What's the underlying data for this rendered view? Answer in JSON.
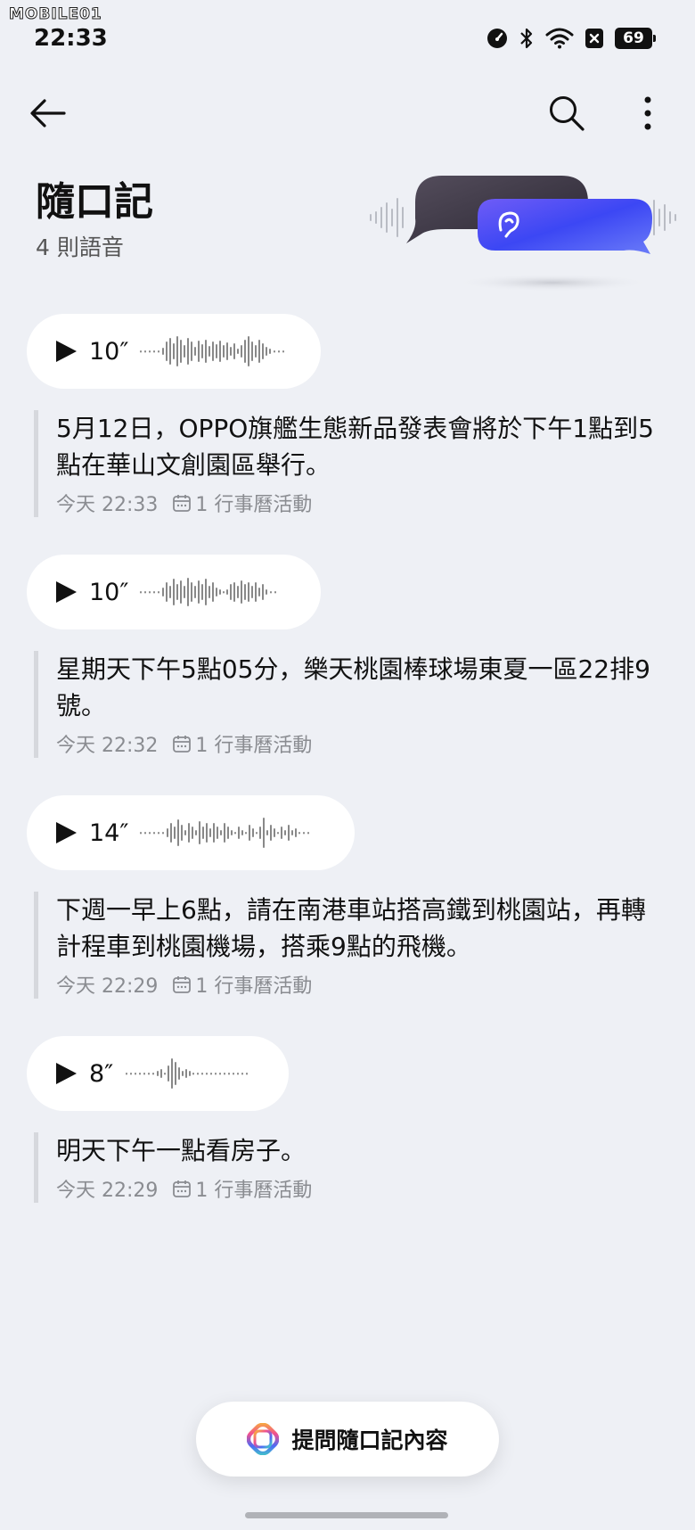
{
  "watermark": "MOBILE01",
  "status_bar": {
    "time": "22:33",
    "battery": "69",
    "icons": [
      "speed-icon",
      "bluetooth-icon",
      "wifi-icon",
      "notification-x-icon",
      "battery-icon"
    ]
  },
  "header": {
    "back_icon": "arrow-left-icon",
    "search_icon": "search-icon",
    "more_icon": "more-vertical-icon"
  },
  "page": {
    "title": "隨口記",
    "subtitle": "4 則語音"
  },
  "entries": [
    {
      "duration": "10″",
      "text": "5月12日，OPPO旗艦生態新品發表會將於下午1點到5點在華山文創園區舉行。",
      "time": "今天 22:33",
      "calendar_label": "1 行事曆活動"
    },
    {
      "duration": "10″",
      "text": "星期天下午5點05分，樂天桃園棒球場東夏一區22排9號。",
      "time": "今天 22:32",
      "calendar_label": "1 行事曆活動"
    },
    {
      "duration": "14″",
      "text": "下週一早上6點，請在南港車站搭高鐵到桃園站，再轉計程車到桃園機場，搭乘9點的飛機。",
      "time": "今天 22:29",
      "calendar_label": "1 行事曆活動"
    },
    {
      "duration": "8″",
      "text": "明天下午一點看房子。",
      "time": "今天 22:29",
      "calendar_label": "1 行事曆活動"
    }
  ],
  "ask_button": {
    "label": "提問隨口記內容",
    "icon": "ai-sparkle-icon"
  },
  "colors": {
    "background": "#eef0f5",
    "accent_blue": "#4a4cf5",
    "dark_bubble": "#3a3545"
  }
}
